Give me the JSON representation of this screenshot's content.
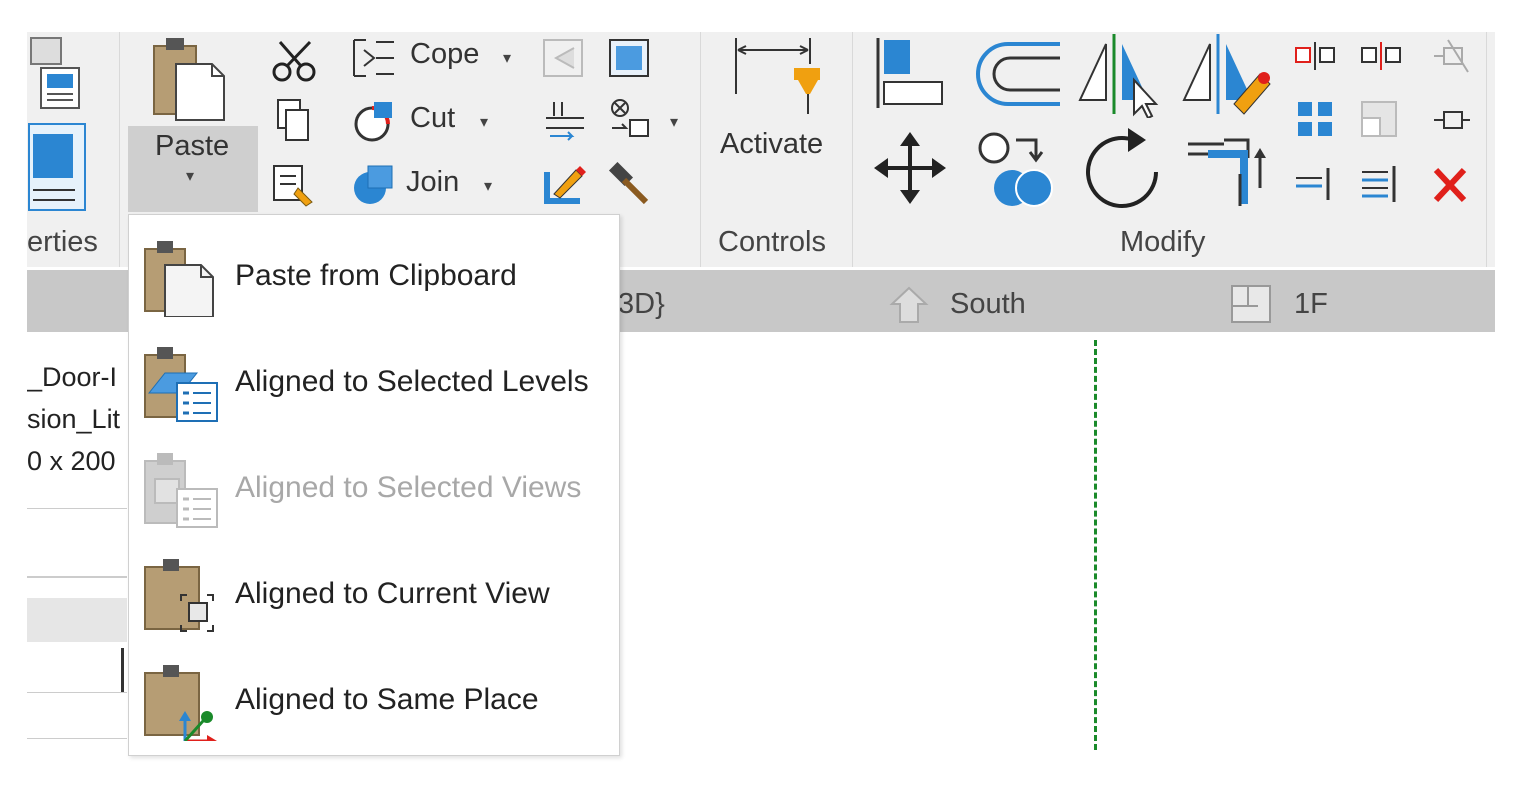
{
  "ribbon": {
    "clipboard": {
      "paste_label": "Paste",
      "paste_caret": "▾"
    },
    "geometry": {
      "cope_label": "Cope",
      "cut_label": "Cut",
      "join_label": "Join",
      "caret": "▾"
    },
    "controls": {
      "activate_label": "Activate",
      "panel_title": "Controls"
    },
    "modify": {
      "panel_title": "Modify"
    },
    "properties": {
      "panel_title_partial": "erties"
    }
  },
  "view_tabs": {
    "tab1_partial": "3D}",
    "tab2": "South",
    "tab3": "1F"
  },
  "properties_panel": {
    "line1": "_Door-I",
    "line2": "sion_Lit",
    "line3": "0 x 200"
  },
  "paste_menu": {
    "items": [
      {
        "label": "Paste from Clipboard",
        "enabled": true
      },
      {
        "label": "Aligned to Selected Levels",
        "enabled": true
      },
      {
        "label": "Aligned to Selected Views",
        "enabled": false
      },
      {
        "label": "Aligned to Current View",
        "enabled": true
      },
      {
        "label": "Aligned to Same Place",
        "enabled": true
      }
    ]
  },
  "colors": {
    "clipboard_brown": "#b69d74",
    "accent_blue": "#2b86d2",
    "close_red": "#e0201b",
    "pin_orange": "#f0a010",
    "dashed_green": "#1a8a2a"
  }
}
